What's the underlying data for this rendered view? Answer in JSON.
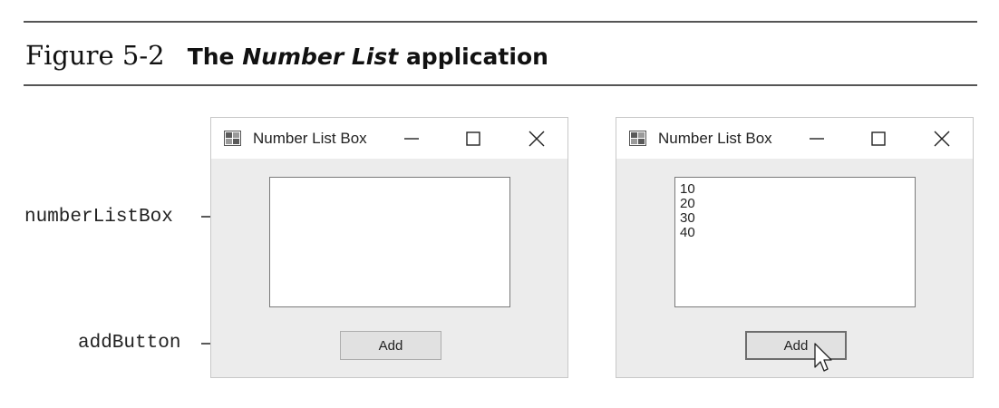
{
  "figure": {
    "number": "Figure 5-2",
    "title_prefix": "The",
    "title_italic": "Number List",
    "title_suffix": "application"
  },
  "callouts": {
    "listbox_label": "numberListBox",
    "button_label": "addButton"
  },
  "windows": [
    {
      "title": "Number List Box",
      "list_items": [],
      "button_label": "Add"
    },
    {
      "title": "Number List Box",
      "list_items": [
        "10",
        "20",
        "30",
        "40"
      ],
      "button_label": "Add"
    }
  ]
}
